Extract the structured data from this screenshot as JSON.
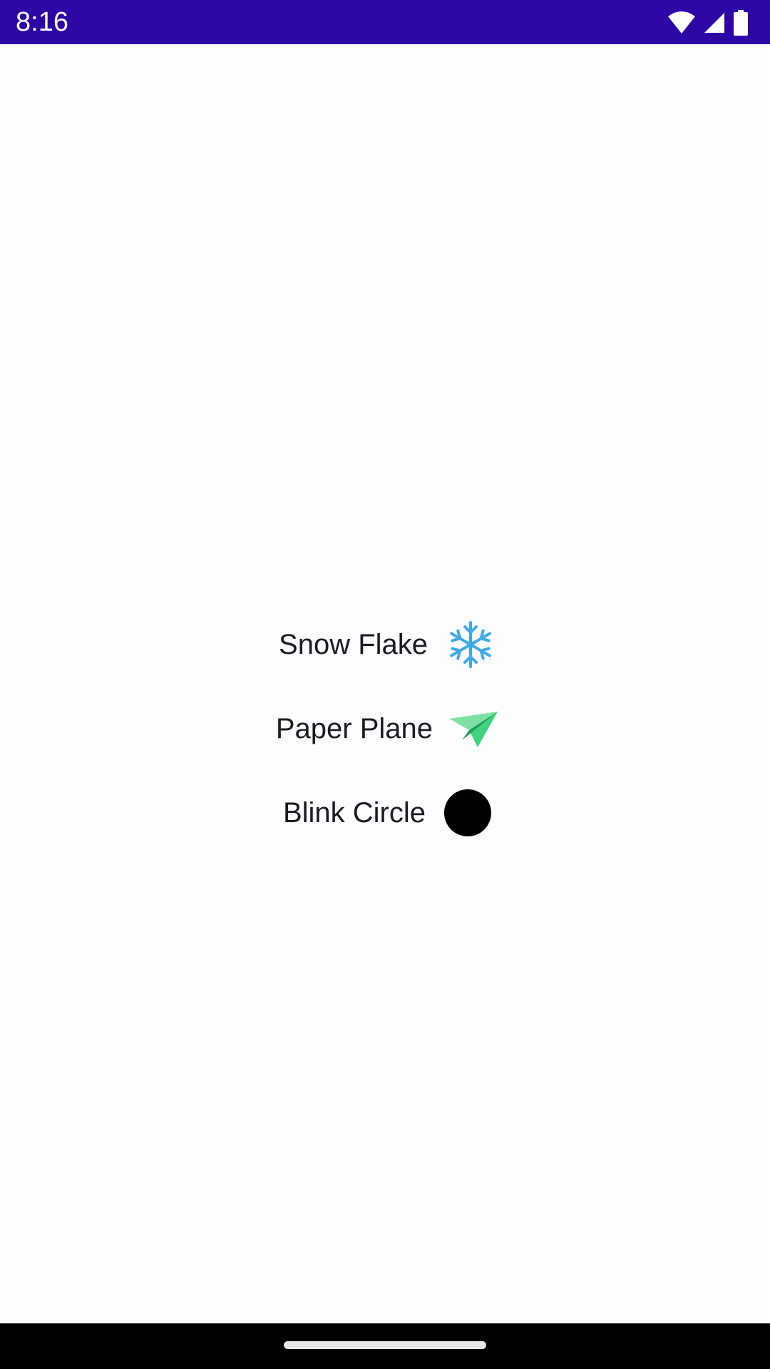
{
  "status_bar": {
    "time": "8:16",
    "background_color": "#2f06a6",
    "icons": [
      "wifi-icon",
      "cellular-signal-icon",
      "battery-icon"
    ]
  },
  "content": {
    "items": [
      {
        "label": "Snow Flake",
        "icon": "snowflake-icon",
        "icon_color": "#3fa9e6"
      },
      {
        "label": "Paper Plane",
        "icon": "paper-plane-icon",
        "icon_color": "#3fd27f"
      },
      {
        "label": "Blink Circle",
        "icon": "circle-icon",
        "icon_color": "#000000"
      }
    ]
  },
  "nav_bar": {
    "background_color": "#000000",
    "handle": "home-gesture-handle"
  }
}
